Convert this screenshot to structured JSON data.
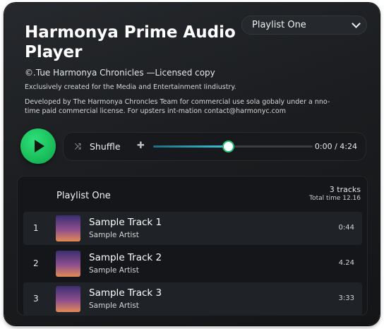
{
  "app": {
    "title": "Harmonya Prime Audio Player",
    "copyright": "©.Tue Harmonya Chronicles —Licensed copy",
    "exclusive": "Exclusively created for the Media and Entertainment Iindiustry.",
    "license": "Developed by The Harmonya Chroncles Team for commercial use  sola gobaly under a nno-time paid commercial license. For upsters int-mation contact@harmonyc.com"
  },
  "playlist_selector": {
    "value": "Playlist One"
  },
  "controls": {
    "shuffle_label": "Shuffle",
    "shuffle_icon": "shuffle-icon",
    "volume_icon": "plus-icon",
    "play_icon": "play-icon",
    "time": "0:00 / 4:24",
    "progress": 0.47,
    "accent": "#1fbd72"
  },
  "playlist": {
    "title": "Playlist One",
    "track_count": "3 tracks",
    "total_time": "Total time 12.16",
    "tracks": [
      {
        "num": "1",
        "name": "Sample Track 1",
        "artist": "Sample Artist",
        "duration": "0:44"
      },
      {
        "num": "2",
        "name": "Sample Track 2",
        "artist": "Sample Artist",
        "duration": "4.24"
      },
      {
        "num": "3",
        "name": "Sample Track 3",
        "artist": "Sample Artist",
        "duration": "3:33"
      }
    ]
  }
}
